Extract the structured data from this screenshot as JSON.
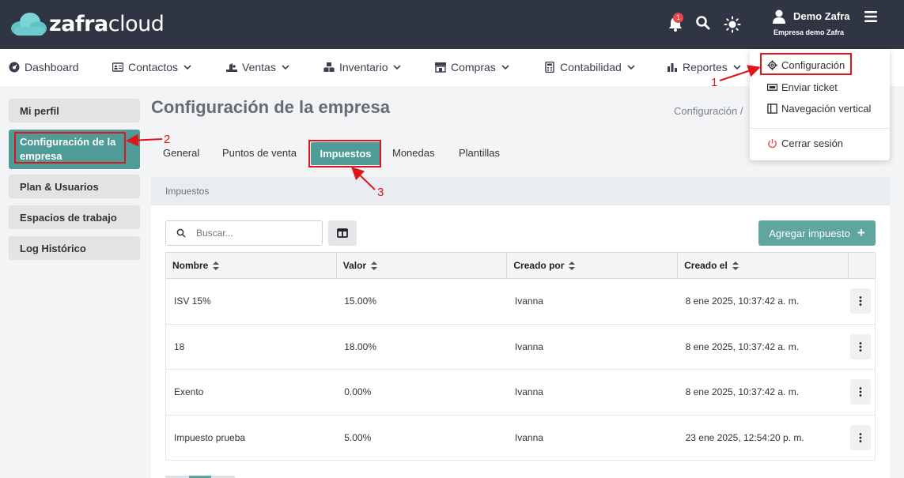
{
  "header": {
    "logo_bold": "zafra",
    "logo_light": "cloud",
    "notification_count": "1",
    "user_name": "Demo Zafra",
    "company_name": "Empresa demo Zafra"
  },
  "nav": {
    "items": [
      {
        "label": "Dashboard",
        "icon": "dashboard-icon"
      },
      {
        "label": "Contactos",
        "icon": "contacts-icon"
      },
      {
        "label": "Ventas",
        "icon": "sales-icon"
      },
      {
        "label": "Inventario",
        "icon": "inventory-icon"
      },
      {
        "label": "Compras",
        "icon": "store-icon"
      },
      {
        "label": "Contabilidad",
        "icon": "calculator-icon"
      },
      {
        "label": "Reportes",
        "icon": "bar-chart-icon"
      }
    ]
  },
  "user_menu": {
    "items": [
      {
        "label": "Configuración",
        "icon": "gear-icon"
      },
      {
        "label": "Enviar ticket",
        "icon": "ticket-icon"
      },
      {
        "label": "Navegación vertical",
        "icon": "layout-icon"
      },
      {
        "label": "Cerrar sesión",
        "icon": "power-icon"
      }
    ]
  },
  "sidebar": {
    "items": [
      {
        "label": "Mi perfil"
      },
      {
        "label": "Configuración de la empresa"
      },
      {
        "label": "Plan & Usuarios"
      },
      {
        "label": "Espacios de trabajo"
      },
      {
        "label": "Log Histórico"
      }
    ]
  },
  "main": {
    "title": "Configuración de la empresa",
    "breadcrumb": "Configuración  /",
    "tabs": [
      {
        "label": "General"
      },
      {
        "label": "Puntos de venta"
      },
      {
        "label": "Impuestos"
      },
      {
        "label": "Monedas"
      },
      {
        "label": "Plantillas"
      }
    ],
    "section_title": "Impuestos",
    "search_placeholder": "Buscar...",
    "add_button": "Agregar impuesto",
    "table": {
      "columns": [
        "Nombre",
        "Valor",
        "Creado por",
        "Creado el"
      ],
      "rows": [
        [
          "ISV 15%",
          "15.00%",
          "Ivanna",
          "8 ene 2025, 10:37:42 a. m."
        ],
        [
          "18",
          "18.00%",
          "Ivanna",
          "8 ene 2025, 10:37:42 a. m."
        ],
        [
          "Exento",
          "0.00%",
          "Ivanna",
          "8 ene 2025, 10:37:42 a. m."
        ],
        [
          "Impuesto prueba",
          "5.00%",
          "Ivanna",
          "23 ene 2025, 12:54:20 p. m."
        ]
      ]
    }
  },
  "annotations": {
    "step1": "1",
    "step2": "2",
    "step3": "3",
    "color": "#e0141a"
  },
  "colors": {
    "topbar": "#2f3542",
    "accent": "#4e9b97",
    "logo_cloud": "#5fc3c8"
  }
}
